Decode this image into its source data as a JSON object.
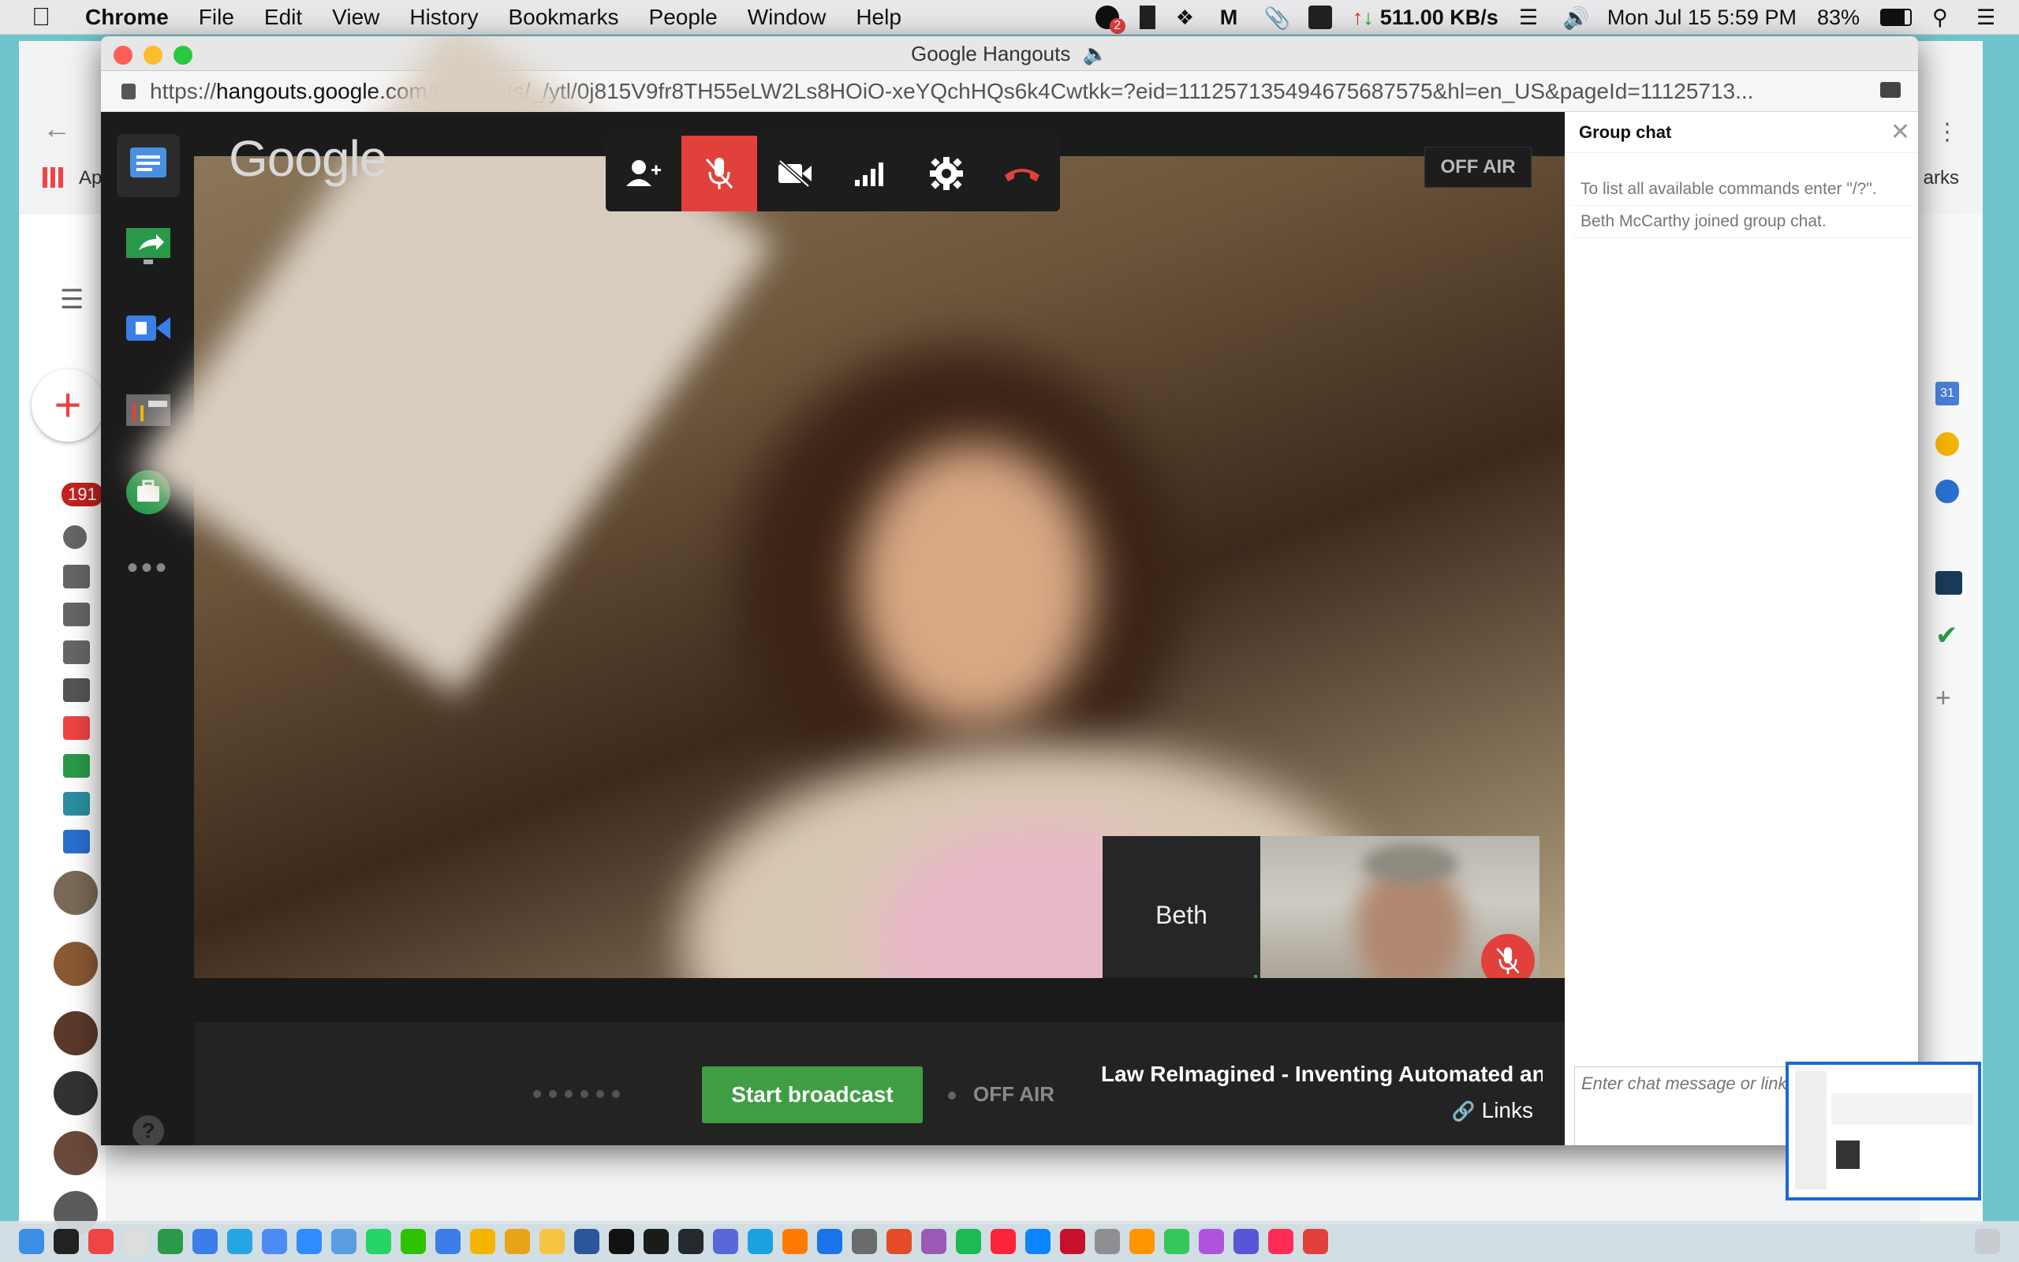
{
  "menubar": {
    "app_name": "Chrome",
    "menus": [
      "File",
      "Edit",
      "View",
      "History",
      "Bookmarks",
      "People",
      "Window",
      "Help"
    ],
    "notification_count": "2",
    "network_speed": "511.00 KB/s",
    "datetime": "Mon Jul 15  5:59 PM",
    "battery": "83%"
  },
  "background_window": {
    "bookmarks_apps": "Ap",
    "bookmarks_other": "arks",
    "unread_badge": "191",
    "calendar_day": "31"
  },
  "window": {
    "title": "Google Hangouts",
    "url_prefix": "https://",
    "url_host": "hangouts.google.com",
    "url_path": "/hangouts/_/ytl/0j815V9fr8TH55eLW2Ls8HOiO-xeYQchHQs6k4Cwtkk=?eid=111257135494675687575&hl=en_US&pageId=11125713..."
  },
  "hangout": {
    "logo": "Google",
    "off_air_top": "OFF AIR",
    "participant_name": "Beth",
    "start_broadcast": "Start broadcast",
    "off_air_bottom": "OFF AIR",
    "event_title": "Law ReImagined - Inventing Automated and A...",
    "links_label": "Links",
    "help": "?"
  },
  "chat": {
    "title": "Group chat",
    "messages": [
      "To list all available commands enter \"/?\".",
      "Beth McCarthy joined group chat."
    ],
    "placeholder": "Enter chat message or link here"
  },
  "colors": {
    "mute_red": "#e2413b",
    "broadcast_green": "#3f9e44",
    "dark_bg": "#1e1e1e"
  }
}
